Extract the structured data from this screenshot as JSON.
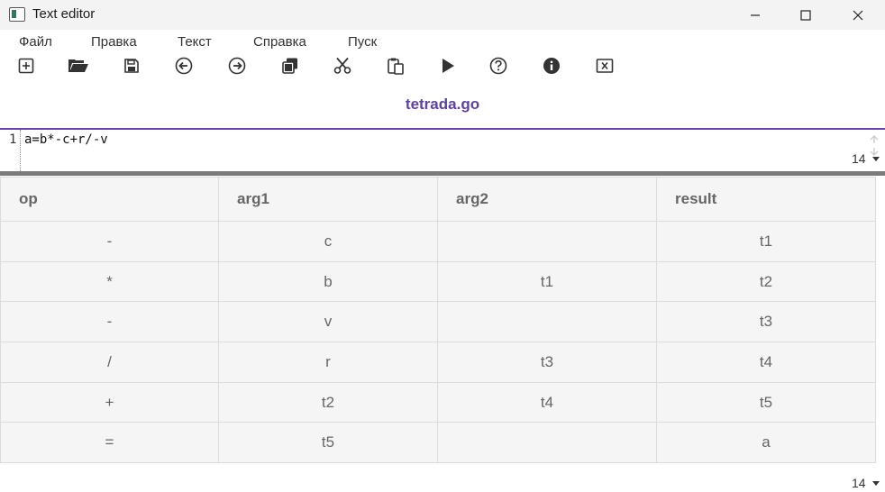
{
  "window": {
    "title": "Text editor",
    "icon": "app-window-icon",
    "controls": [
      "minimize-icon",
      "maximize-icon",
      "close-icon"
    ]
  },
  "menu": {
    "items": [
      {
        "label": "Файл"
      },
      {
        "label": "Правка"
      },
      {
        "label": "Текст"
      },
      {
        "label": "Справка"
      },
      {
        "label": "Пуск"
      }
    ]
  },
  "toolbar": {
    "icons": [
      "new-file-icon",
      "open-folder-icon",
      "save-icon",
      "undo-icon",
      "redo-icon",
      "copy-icon",
      "cut-icon",
      "paste-icon",
      "run-icon",
      "help-icon",
      "info-icon",
      "exit-icon"
    ]
  },
  "file": {
    "name": "tetrada.go"
  },
  "editor": {
    "line_number": "1",
    "code": "a=b*-c+r/-v",
    "font_size": "14"
  },
  "table": {
    "headers": [
      "op",
      "arg1",
      "arg2",
      "result"
    ],
    "rows": [
      [
        "-",
        "c",
        "",
        "t1"
      ],
      [
        "*",
        "b",
        "t1",
        "t2"
      ],
      [
        "-",
        "v",
        "",
        "t3"
      ],
      [
        "/",
        "r",
        "t3",
        "t4"
      ],
      [
        "+",
        "t2",
        "t4",
        "t5"
      ],
      [
        "=",
        "t5",
        "",
        "a"
      ]
    ]
  },
  "output": {
    "font_size": "14"
  },
  "colors": {
    "accent": "#6a3fb0",
    "filename": "#5d3fa8",
    "splitter": "#7b7b7b"
  }
}
